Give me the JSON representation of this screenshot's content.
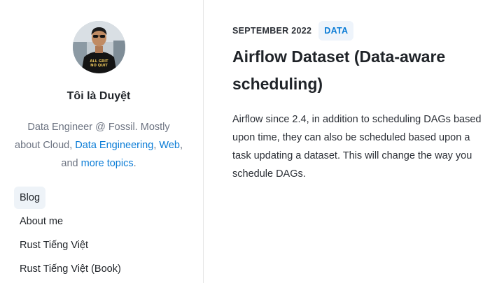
{
  "author": {
    "name": "Tôi là Duyệt",
    "bio_prefix": "Data Engineer @ Fossil. Mostly about Cloud, ",
    "bio_link_1": "Data Engineering",
    "bio_sep_1": ", ",
    "bio_link_2": "Web",
    "bio_sep_2": ", and ",
    "bio_link_3": "more topics",
    "bio_suffix": "."
  },
  "nav": {
    "items": [
      {
        "label": "Blog",
        "active": true
      },
      {
        "label": "About me"
      },
      {
        "label": "Rust Tiếng Việt"
      },
      {
        "label": "Rust Tiếng Việt (Book)"
      }
    ]
  },
  "post": {
    "date": "SEPTEMBER 2022",
    "tag": "DATA",
    "title": "Airflow Dataset (Data-aware scheduling)",
    "excerpt": "Airflow since 2.4, in addition to scheduling DAGs based upon time, they can also be scheduled based upon a task updating a dataset. This will change the way you schedule DAGs."
  },
  "avatar_shirt_text": "ALL GRIT NO QUIT",
  "colors": {
    "link": "#0a7cd6",
    "tag_bg": "#eef4fb",
    "nav_active_bg": "#eef3f8",
    "muted_text": "#6b7280"
  }
}
